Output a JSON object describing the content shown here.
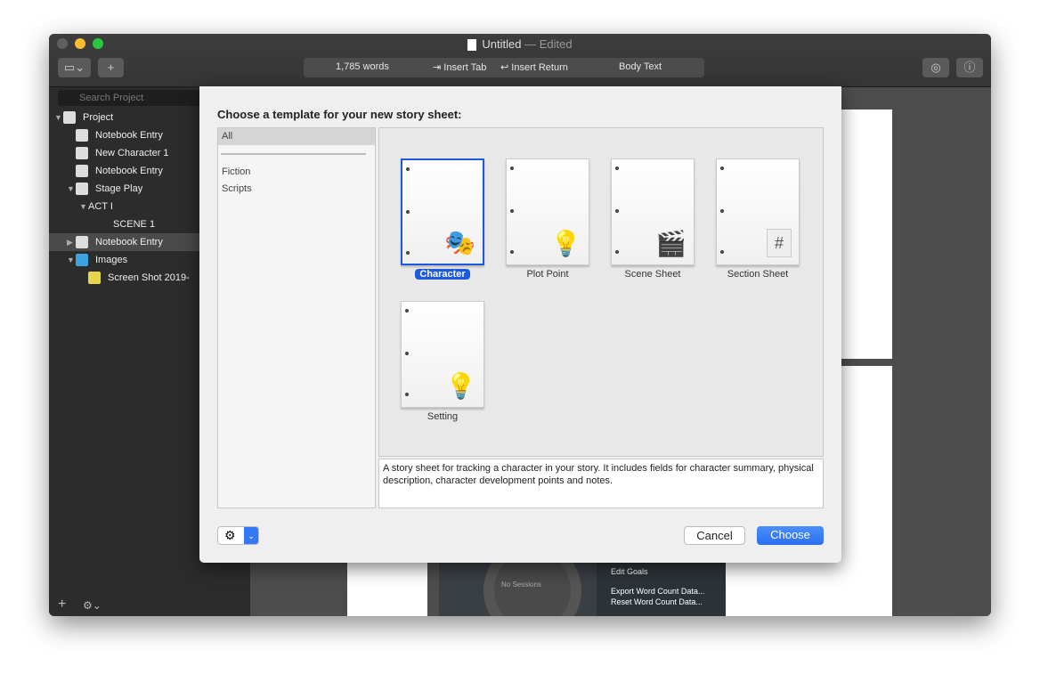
{
  "window": {
    "title": "Untitled",
    "title_suffix": "— Edited"
  },
  "toolbar": {
    "word_count": "1,785 words",
    "insert_tab": "⇥ Insert Tab",
    "insert_return": "↩ Insert Return",
    "style": "Body Text"
  },
  "sidebar": {
    "search_placeholder": "Search Project",
    "items": [
      {
        "label": "Project",
        "icon": "project-icon",
        "indent": 0,
        "tri": "▼"
      },
      {
        "label": "Notebook Entry",
        "icon": "notebook-icon",
        "indent": 1,
        "tri": ""
      },
      {
        "label": "New Character 1",
        "icon": "masks-icon",
        "indent": 1,
        "tri": ""
      },
      {
        "label": "Notebook Entry",
        "icon": "notebook-icon",
        "indent": 1,
        "tri": ""
      },
      {
        "label": "Stage Play",
        "icon": "notebook-icon",
        "indent": 1,
        "tri": "▼"
      },
      {
        "label": "ACT I",
        "icon": "",
        "indent": 2,
        "tri": "▼"
      },
      {
        "label": "SCENE 1",
        "icon": "",
        "indent": 3,
        "tri": ""
      },
      {
        "label": "Notebook Entry",
        "icon": "notebook-icon",
        "indent": 1,
        "tri": "▶",
        "selected": true
      },
      {
        "label": "Images",
        "icon": "folder-icon",
        "indent": 1,
        "tri": "▼"
      },
      {
        "label": "Screen Shot 2019-",
        "icon": "image-icon",
        "indent": 2,
        "tri": ""
      }
    ]
  },
  "background_panel": {
    "sessions": "No Sessions",
    "menu": [
      "Edit Goals",
      "Export Word Count Data...",
      "Reset Word Count Data..."
    ]
  },
  "dialog": {
    "title": "Choose a template for your new story sheet:",
    "categories": [
      "All",
      "Fiction",
      "Scripts"
    ],
    "selected_category": "All",
    "templates": [
      {
        "label": "Character",
        "icon": "theater-masks-icon",
        "glyph": "🎭",
        "selected": true
      },
      {
        "label": "Plot Point",
        "icon": "lightbulb-icon",
        "glyph": "💡"
      },
      {
        "label": "Scene Sheet",
        "icon": "clapperboard-icon",
        "glyph": "🎬"
      },
      {
        "label": "Section Sheet",
        "icon": "hash-icon",
        "glyph": "#"
      },
      {
        "label": "Setting",
        "icon": "spotlight-icon",
        "glyph": "💡"
      }
    ],
    "description": "A story sheet for tracking a character in your story. It includes fields for character summary, physical description, character development points and notes.",
    "cancel": "Cancel",
    "choose": "Choose"
  },
  "colors": {
    "accent": "#1d5ae0",
    "choose_button": "#3478f6"
  }
}
